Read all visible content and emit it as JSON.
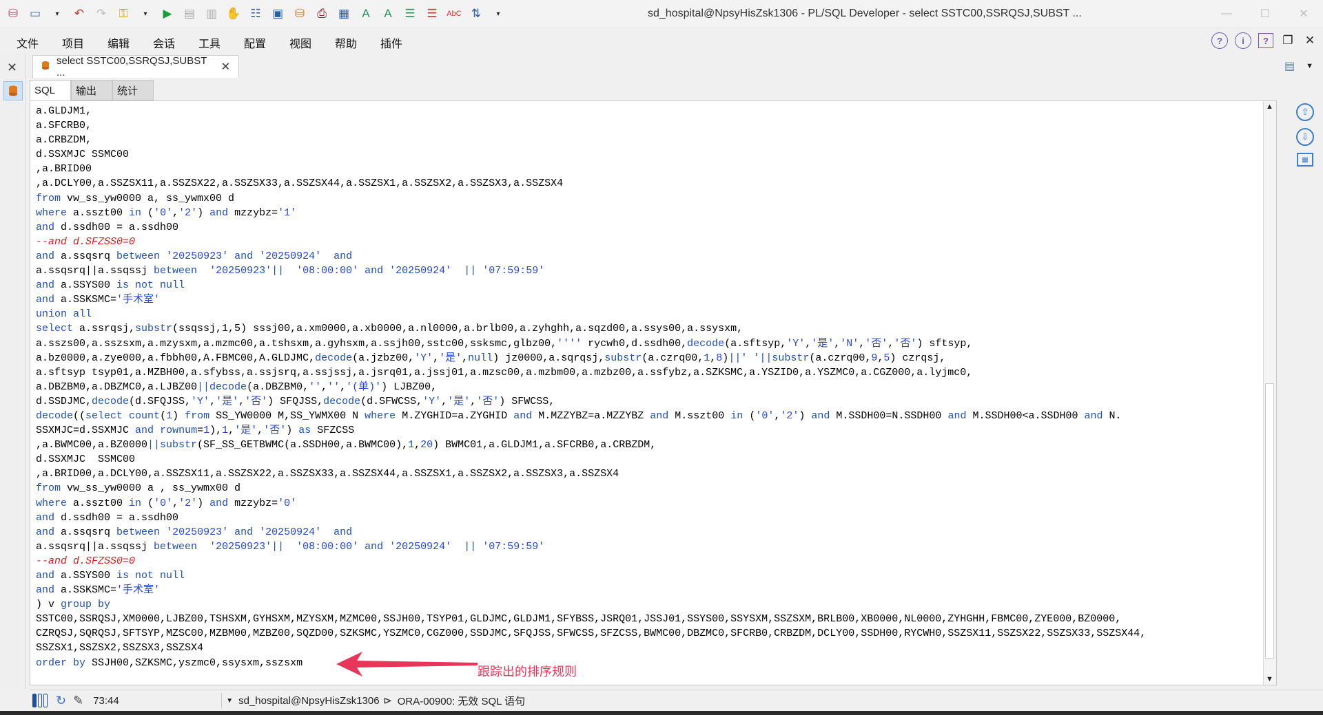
{
  "window": {
    "title": "sd_hospital@NpsyHisZsk1306 - PL/SQL Developer - select SSTC00,SSRQSJ,SUBST ...",
    "controls": [
      "minimize",
      "maximize",
      "close"
    ]
  },
  "menu": {
    "items": [
      "文件",
      "项目",
      "编辑",
      "会话",
      "工具",
      "配置",
      "视图",
      "帮助",
      "插件"
    ]
  },
  "tab": {
    "label": "select SSTC00,SSRQSJ,SUBST ..."
  },
  "subtabs": [
    "SQL",
    "输出",
    "统计"
  ],
  "editor": {
    "lines": [
      [
        [
          "",
          "a.GLDJM1,"
        ]
      ],
      [
        [
          "",
          "a.SFCRB0,"
        ]
      ],
      [
        [
          "",
          "a.CRBZDM,"
        ]
      ],
      [
        [
          "",
          "d.SSXMJC SSMC00"
        ]
      ],
      [
        [
          "",
          ",a.BRID00"
        ]
      ],
      [
        [
          "",
          ",a.DCLY00,a.SSZSX11,a.SSZSX22,a.SSZSX33,a.SSZSX44,a.SSZSX1,a.SSZSX2,a.SSZSX3,a.SSZSX4"
        ]
      ],
      [
        [
          "kw",
          "from"
        ],
        [
          "",
          " vw_ss_yw0000 a, ss_ywmx00 d"
        ]
      ],
      [
        [
          "kw",
          "where"
        ],
        [
          "",
          " a.sszt00 "
        ],
        [
          "kw",
          "in"
        ],
        [
          "",
          " ("
        ],
        [
          "str",
          "'0'"
        ],
        [
          "",
          ","
        ],
        [
          "str",
          "'2'"
        ],
        [
          "",
          ") "
        ],
        [
          "kw",
          "and"
        ],
        [
          "",
          " mzzybz="
        ],
        [
          "str",
          "'1'"
        ]
      ],
      [
        [
          "kw",
          "and"
        ],
        [
          "",
          " d.ssdh00 = a.ssdh00"
        ]
      ],
      [
        [
          "cm",
          "--and d.SFZSS0=0"
        ]
      ],
      [
        [
          "kw",
          "and"
        ],
        [
          "",
          " a.ssqsrq "
        ],
        [
          "kw",
          "between"
        ],
        [
          "",
          " "
        ],
        [
          "str",
          "'20250923'"
        ],
        [
          "",
          " "
        ],
        [
          "kw",
          "and"
        ],
        [
          "",
          " "
        ],
        [
          "str",
          "'20250924'"
        ],
        [
          "",
          "  "
        ],
        [
          "kw",
          "and"
        ]
      ],
      [
        [
          "",
          "a.ssqsrq||a.ssqssj "
        ],
        [
          "kw",
          "between"
        ],
        [
          "",
          "  "
        ],
        [
          "str",
          "'20250923'"
        ],
        [
          "kw",
          "||"
        ],
        [
          "",
          "  "
        ],
        [
          "str",
          "'08:00:00'"
        ],
        [
          "",
          " "
        ],
        [
          "kw",
          "and"
        ],
        [
          "",
          " "
        ],
        [
          "str",
          "'20250924'"
        ],
        [
          "",
          "  "
        ],
        [
          "kw",
          "||"
        ],
        [
          "",
          " "
        ],
        [
          "str",
          "'07:59:59'"
        ]
      ],
      [
        [
          "kw",
          "and"
        ],
        [
          "",
          " a.SSYS00 "
        ],
        [
          "kw",
          "is not null"
        ]
      ],
      [
        [
          "kw",
          "and"
        ],
        [
          "",
          " a.SSKSMC="
        ],
        [
          "str",
          "'手术室'"
        ]
      ],
      [
        [
          "kw",
          "union all"
        ]
      ],
      [
        [
          "kw",
          "select"
        ],
        [
          "",
          " a.ssrqsj,"
        ],
        [
          "kw",
          "substr"
        ],
        [
          "",
          "(ssqssj,1,5) sssj00,a.xm0000,a.xb0000,a.nl0000,a.brlb00,a.zyhghh,a.sqzd00,a.ssys00,a.ssysxm,"
        ]
      ],
      [
        [
          "",
          "a.sszs00,a.sszsxm,a.mzysxm,a.mzmc00,a.tshsxm,a.gyhsxm,a.ssjh00,sstc00,ssksmc,glbz00,"
        ],
        [
          "str",
          "''''"
        ],
        [
          "",
          " rycwh0,d.ssdh00,"
        ],
        [
          "kw",
          "decode"
        ],
        [
          "",
          "(a.sftsyp,"
        ],
        [
          "str",
          "'Y'"
        ],
        [
          "",
          ","
        ],
        [
          "str",
          "'是'"
        ],
        [
          "",
          ","
        ],
        [
          "str",
          "'N'"
        ],
        [
          "",
          ","
        ],
        [
          "str",
          "'否'"
        ],
        [
          "",
          ","
        ],
        [
          "str",
          "'否'"
        ],
        [
          "",
          ") sftsyp,"
        ]
      ],
      [
        [
          "",
          "a.bz0000,a.zye000,a.fbbh00,A.FBMC00,A.GLDJMC,"
        ],
        [
          "kw",
          "decode"
        ],
        [
          "",
          "(a.jzbz00,"
        ],
        [
          "str",
          "'Y'"
        ],
        [
          "",
          ","
        ],
        [
          "str",
          "'是'"
        ],
        [
          "",
          ","
        ],
        [
          "kw",
          "null"
        ],
        [
          "",
          ") jz0000,a.sqrqsj,"
        ],
        [
          "kw",
          "substr"
        ],
        [
          "",
          "(a.czrq00,"
        ],
        [
          "str",
          "1"
        ],
        [
          "",
          ","
        ],
        [
          "str",
          "8"
        ],
        [
          "",
          ")"
        ],
        [
          "kw",
          "||"
        ],
        [
          "str",
          "' '"
        ],
        [
          "kw",
          "||substr"
        ],
        [
          "",
          "(a.czrq00,"
        ],
        [
          "str",
          "9"
        ],
        [
          "",
          ","
        ],
        [
          "str",
          "5"
        ],
        [
          "",
          ") czrqsj,"
        ]
      ],
      [
        [
          "",
          "a.sftsyp tsyp01,a.MZBH00,a.sfybss,a.ssjsrq,a.ssjssj,a.jsrq01,a.jssj01,a.mzsc00,a.mzbm00,a.mzbz00,a.ssfybz,a.SZKSMC,a.YSZID0,a.YSZMC0,a.CGZ000,a.lyjmc0,"
        ]
      ],
      [
        [
          "",
          "a.DBZBM0,a.DBZMC0,a.LJBZ00"
        ],
        [
          "kw",
          "||decode"
        ],
        [
          "",
          "(a.DBZBM0,"
        ],
        [
          "str",
          "''"
        ],
        [
          "",
          ","
        ],
        [
          "str",
          "''"
        ],
        [
          "",
          ","
        ],
        [
          "str",
          "'(单)'"
        ],
        [
          "",
          ") LJBZ00,"
        ]
      ],
      [
        [
          "",
          "d.SSDJMC,"
        ],
        [
          "kw",
          "decode"
        ],
        [
          "",
          "(d.SFQJSS,"
        ],
        [
          "str",
          "'Y'"
        ],
        [
          "",
          ","
        ],
        [
          "str",
          "'是'"
        ],
        [
          "",
          ","
        ],
        [
          "str",
          "'否'"
        ],
        [
          "",
          ") SFQJSS,"
        ],
        [
          "kw",
          "decode"
        ],
        [
          "",
          "(d.SFWCSS,"
        ],
        [
          "str",
          "'Y'"
        ],
        [
          "",
          ","
        ],
        [
          "str",
          "'是'"
        ],
        [
          "",
          ","
        ],
        [
          "str",
          "'否'"
        ],
        [
          "",
          ") SFWCSS,"
        ]
      ],
      [
        [
          "kw",
          "decode"
        ],
        [
          "",
          "(("
        ],
        [
          "kw",
          "select count"
        ],
        [
          "",
          "("
        ],
        [
          "str",
          "1"
        ],
        [
          "",
          ") "
        ],
        [
          "kw",
          "from"
        ],
        [
          "",
          " SS_YW0000 M,SS_YWMX00 N "
        ],
        [
          "kw",
          "where"
        ],
        [
          "",
          " M.ZYGHID=a.ZYGHID "
        ],
        [
          "kw",
          "and"
        ],
        [
          "",
          " M.MZZYBZ=a.MZZYBZ "
        ],
        [
          "kw",
          "and"
        ],
        [
          "",
          " M.sszt00 "
        ],
        [
          "kw",
          "in"
        ],
        [
          "",
          " ("
        ],
        [
          "str",
          "'0'"
        ],
        [
          "",
          ","
        ],
        [
          "str",
          "'2'"
        ],
        [
          "",
          ") "
        ],
        [
          "kw",
          "and"
        ],
        [
          "",
          " M.SSDH00=N.SSDH00 "
        ],
        [
          "kw",
          "and"
        ],
        [
          "",
          " M.SSDH00<a.SSDH00 "
        ],
        [
          "kw",
          "and"
        ],
        [
          "",
          " N."
        ]
      ],
      [
        [
          "",
          "SSXMJC=d.SSXMJC "
        ],
        [
          "kw",
          "and"
        ],
        [
          "",
          " "
        ],
        [
          "kw",
          "rownum"
        ],
        [
          "",
          "="
        ],
        [
          "str",
          "1"
        ],
        [
          "",
          "),"
        ],
        [
          "str",
          "1"
        ],
        [
          "",
          ","
        ],
        [
          "str",
          "'是'"
        ],
        [
          "",
          ","
        ],
        [
          "str",
          "'否'"
        ],
        [
          "",
          ") "
        ],
        [
          "kw",
          "as"
        ],
        [
          "",
          " SFZCSS"
        ]
      ],
      [
        [
          "",
          ",a.BWMC00,a.BZ0000"
        ],
        [
          "kw",
          "||substr"
        ],
        [
          "",
          "(SF_SS_GETBWMC(a.SSDH00,a.BWMC00),"
        ],
        [
          "str",
          "1"
        ],
        [
          "",
          ","
        ],
        [
          "str",
          "20"
        ],
        [
          "",
          ") BWMC01,a.GLDJM1,a.SFCRB0,a.CRBZDM,"
        ]
      ],
      [
        [
          "",
          "d.SSXMJC  SSMC00"
        ]
      ],
      [
        [
          "",
          ",a.BRID00,a.DCLY00,a.SSZSX11,a.SSZSX22,a.SSZSX33,a.SSZSX44,a.SSZSX1,a.SSZSX2,a.SSZSX3,a.SSZSX4"
        ]
      ],
      [
        [
          "kw",
          "from"
        ],
        [
          "",
          " vw_ss_yw0000 a , ss_ywmx00 d"
        ]
      ],
      [
        [
          "kw",
          "where"
        ],
        [
          "",
          " a.sszt00 "
        ],
        [
          "kw",
          "in"
        ],
        [
          "",
          " ("
        ],
        [
          "str",
          "'0'"
        ],
        [
          "",
          ","
        ],
        [
          "str",
          "'2'"
        ],
        [
          "",
          ") "
        ],
        [
          "kw",
          "and"
        ],
        [
          "",
          " mzzybz="
        ],
        [
          "str",
          "'0'"
        ]
      ],
      [
        [
          "kw",
          "and"
        ],
        [
          "",
          " d.ssdh00 = a.ssdh00"
        ]
      ],
      [
        [
          "kw",
          "and"
        ],
        [
          "",
          " a.ssqsrq "
        ],
        [
          "kw",
          "between"
        ],
        [
          "",
          " "
        ],
        [
          "str",
          "'20250923'"
        ],
        [
          "",
          " "
        ],
        [
          "kw",
          "and"
        ],
        [
          "",
          " "
        ],
        [
          "str",
          "'20250924'"
        ],
        [
          "",
          "  "
        ],
        [
          "kw",
          "and"
        ]
      ],
      [
        [
          "",
          "a.ssqsrq||a.ssqssj "
        ],
        [
          "kw",
          "between"
        ],
        [
          "",
          "  "
        ],
        [
          "str",
          "'20250923'"
        ],
        [
          "kw",
          "||"
        ],
        [
          "",
          "  "
        ],
        [
          "str",
          "'08:00:00'"
        ],
        [
          "",
          " "
        ],
        [
          "kw",
          "and"
        ],
        [
          "",
          " "
        ],
        [
          "str",
          "'20250924'"
        ],
        [
          "",
          "  "
        ],
        [
          "kw",
          "||"
        ],
        [
          "",
          " "
        ],
        [
          "str",
          "'07:59:59'"
        ]
      ],
      [
        [
          "cm",
          "--and d.SFZSS0=0"
        ]
      ],
      [
        [
          "kw",
          "and"
        ],
        [
          "",
          " a.SSYS00 "
        ],
        [
          "kw",
          "is not null"
        ]
      ],
      [
        [
          "kw",
          "and"
        ],
        [
          "",
          " a.SSKSMC="
        ],
        [
          "str",
          "'手术室'"
        ]
      ],
      [
        [
          "",
          ") v "
        ],
        [
          "kw",
          "group by"
        ]
      ],
      [
        [
          "",
          "SSTC00,SSRQSJ,XM0000,LJBZ00,TSHSXM,GYHSXM,MZYSXM,MZMC00,SSJH00,TSYP01,GLDJMC,GLDJM1,SFYBSS,JSRQ01,JSSJ01,SSYS00,SSYSXM,SSZSXM,BRLB00,XB0000,NL0000,ZYHGHH,FBMC00,ZYE000,BZ0000,"
        ]
      ],
      [
        [
          "",
          "CZRQSJ,SQRQSJ,SFTSYP,MZSC00,MZBM00,MZBZ00,SQZD00,SZKSMC,YSZMC0,CGZ000,SSDJMC,SFQJSS,SFWCSS,SFZCSS,BWMC00,DBZMC0,SFCRB0,CRBZDM,DCLY00,SSDH00,RYCWH0,SSZSX11,SSZSX22,SSZSX33,SSZSX44,"
        ]
      ],
      [
        [
          "",
          "SSZSX1,SSZSX2,SSZSX3,SSZSX4"
        ]
      ],
      [
        [
          "kw",
          "order by"
        ],
        [
          "",
          " SSJH00,SZKSMC,yszmc0,ssysxm,sszsxm"
        ]
      ]
    ]
  },
  "annotation": {
    "text": "跟踪出的排序规则",
    "color": "#e8365a"
  },
  "status": {
    "position": "73:44",
    "connection": "sd_hospital@NpsyHisZsk1306",
    "message": "ORA-00900: 无效 SQL 语句"
  },
  "colors": {
    "keyword": "#1f4fb8",
    "string": "#2447d6",
    "comment": "#e2181c"
  }
}
